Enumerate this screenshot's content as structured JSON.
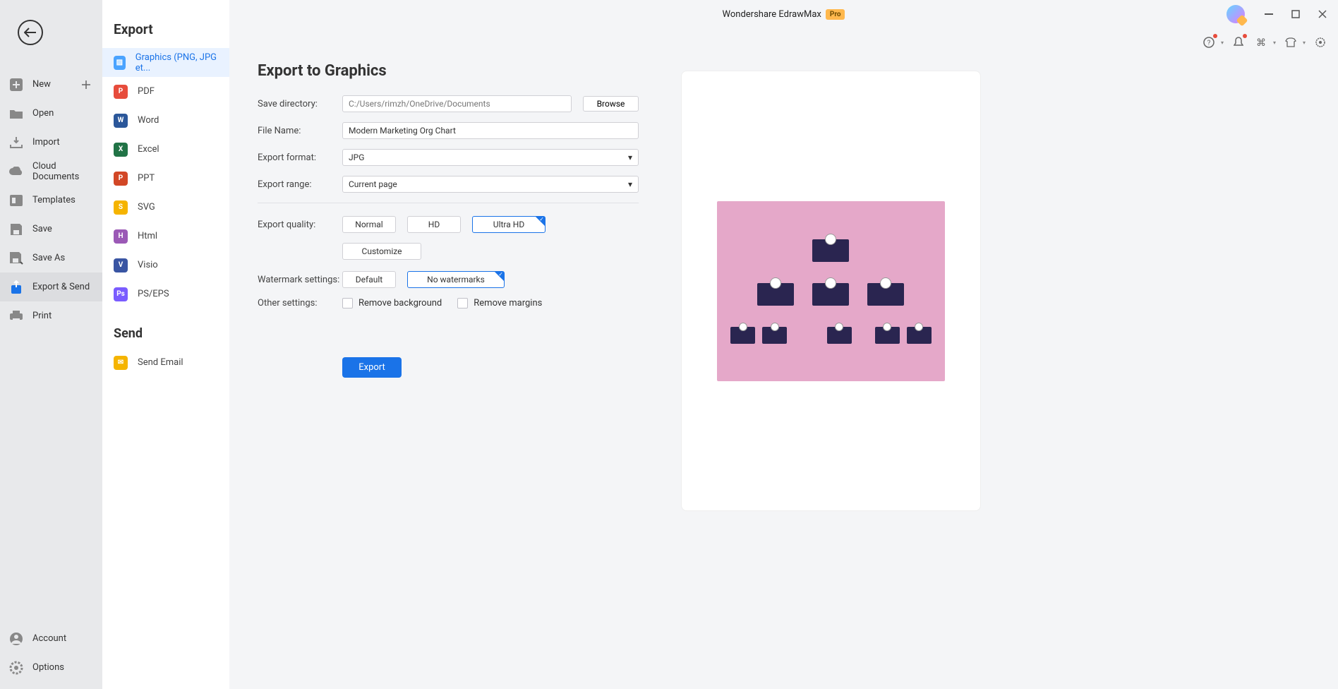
{
  "app": {
    "title": "Wondershare EdrawMax",
    "pro_badge": "Pro"
  },
  "left_nav": {
    "items": [
      {
        "label": "New"
      },
      {
        "label": "Open"
      },
      {
        "label": "Import"
      },
      {
        "label": "Cloud Documents"
      },
      {
        "label": "Templates"
      },
      {
        "label": "Save"
      },
      {
        "label": "Save As"
      },
      {
        "label": "Export & Send"
      },
      {
        "label": "Print"
      }
    ],
    "bottom": [
      {
        "label": "Account"
      },
      {
        "label": "Options"
      }
    ]
  },
  "export_panel": {
    "title": "Export",
    "items": [
      {
        "label": "Graphics (PNG, JPG et...",
        "color": "#4aa3ff"
      },
      {
        "label": "PDF",
        "color": "#e74c3c"
      },
      {
        "label": "Word",
        "color": "#2b579a"
      },
      {
        "label": "Excel",
        "color": "#217346"
      },
      {
        "label": "PPT",
        "color": "#d24726"
      },
      {
        "label": "SVG",
        "color": "#f5b400"
      },
      {
        "label": "Html",
        "color": "#9b59b6"
      },
      {
        "label": "Visio",
        "color": "#3955a3"
      },
      {
        "label": "PS/EPS",
        "color": "#7a5cff"
      }
    ],
    "send_title": "Send",
    "send_items": [
      {
        "label": "Send Email",
        "color": "#f5b400"
      }
    ]
  },
  "form": {
    "heading": "Export to Graphics",
    "labels": {
      "save_dir": "Save directory:",
      "file_name": "File Name:",
      "export_format": "Export format:",
      "export_range": "Export range:",
      "export_quality": "Export quality:",
      "watermark": "Watermark settings:",
      "other": "Other settings:"
    },
    "save_dir_value": "C:/Users/rimzh/OneDrive/Documents",
    "file_name_value": "Modern Marketing Org Chart",
    "export_format_value": "JPG",
    "export_range_value": "Current page",
    "browse_label": "Browse",
    "quality_options": [
      "Normal",
      "HD",
      "Ultra HD"
    ],
    "customize_label": "Customize",
    "watermark_options": [
      "Default",
      "No watermarks"
    ],
    "checkbox_remove_bg": "Remove background",
    "checkbox_remove_margins": "Remove margins",
    "export_btn": "Export"
  }
}
